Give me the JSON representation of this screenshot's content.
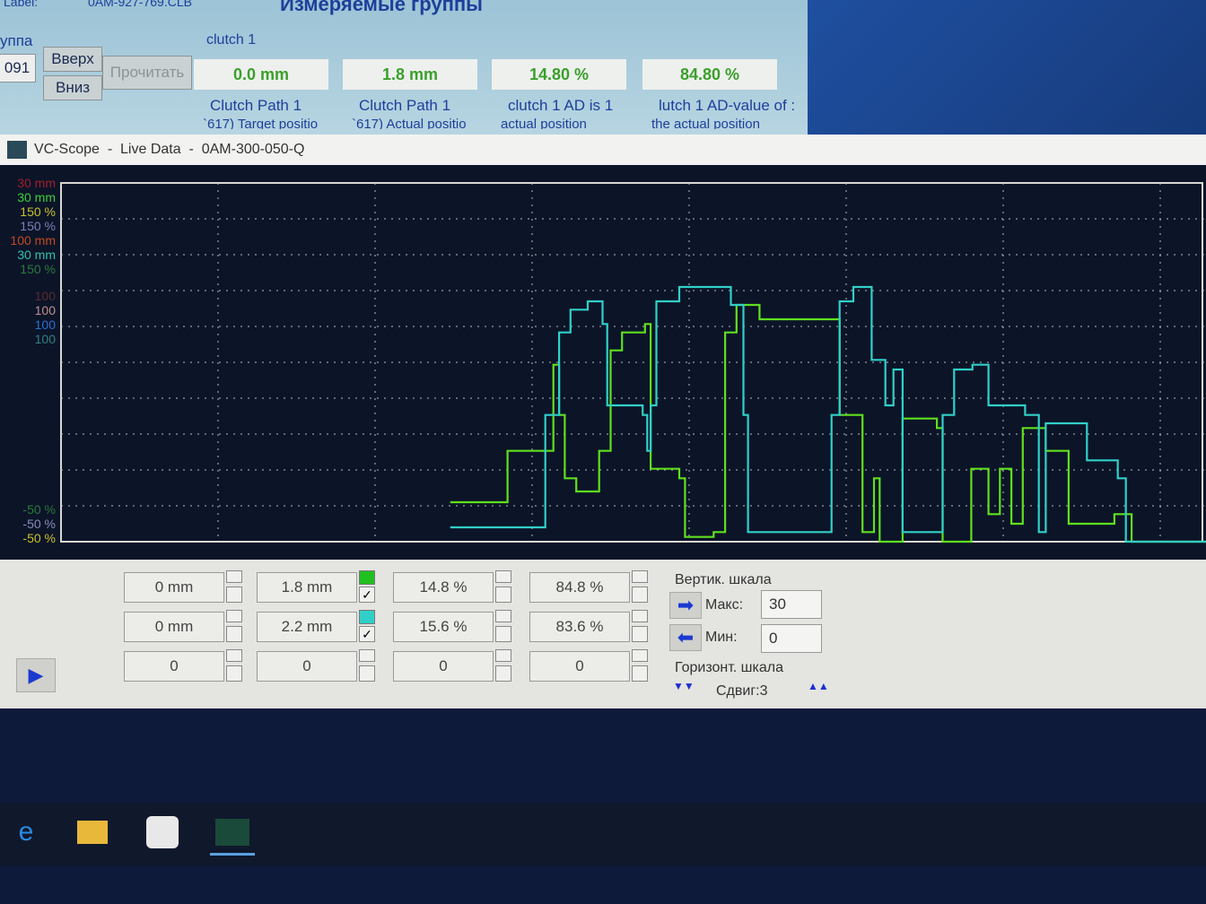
{
  "background_window": {
    "label": "Label:",
    "label_file": "0AM-927-769.CLB",
    "title": "Измеряемые группы",
    "group_label": "уппа",
    "group_value": "091",
    "up_button": "Вверх",
    "down_button": "Вниз",
    "read_button": "Прочитать",
    "section": "clutch 1",
    "values": [
      {
        "value": "0.0 mm",
        "name": "Clutch Path 1",
        "sub": "`617) Target positio"
      },
      {
        "value": "1.8 mm",
        "name": "Clutch Path 1",
        "sub": "`617) Actual positio"
      },
      {
        "value": "14.80 %",
        "name": "clutch 1 AD is 1",
        "sub": "actual position"
      },
      {
        "value": "84.80 %",
        "name": "lutch 1 AD-value of :",
        "sub": "the actual position"
      }
    ]
  },
  "scope": {
    "title": "VC-Scope  -  Live Data  -  0AM-300-050-Q",
    "scale_labels_top": [
      {
        "text": "30 mm",
        "color": "#a0202a"
      },
      {
        "text": "30 mm",
        "color": "#3ad03a"
      },
      {
        "text": "150 %",
        "color": "#c8c030"
      },
      {
        "text": "150 %",
        "color": "#7a80b8"
      },
      {
        "text": "100 mm",
        "color": "#c04a20"
      },
      {
        "text": "30 mm",
        "color": "#30c0b0"
      },
      {
        "text": "150 %",
        "color": "#2a7a3a"
      }
    ],
    "scale_labels_mid": [
      {
        "text": "100",
        "color": "#5a2a30"
      },
      {
        "text": "100",
        "color": "#c09090"
      },
      {
        "text": "100",
        "color": "#2a70d0"
      },
      {
        "text": "100",
        "color": "#308080"
      }
    ],
    "scale_labels_bottom": [
      {
        "text": "-50 %",
        "color": "#2a7a3a"
      },
      {
        "text": "-50 %",
        "color": "#8a8ab8"
      },
      {
        "text": "-50 %",
        "color": "#c8c030"
      }
    ],
    "rows": [
      {
        "cells": [
          "0 mm",
          "1.8 mm",
          "14.8 %",
          "84.8 %"
        ],
        "swatch": "#20c020",
        "checked": true
      },
      {
        "cells": [
          "0 mm",
          "2.2 mm",
          "15.6 %",
          "83.6 %"
        ],
        "swatch": "#30d0c8",
        "checked": true
      },
      {
        "cells": [
          "0",
          "0",
          "0",
          "0"
        ],
        "swatch": null,
        "checked": false
      }
    ],
    "vertical_scale": {
      "label": "Вертик. шкала",
      "max_label": "Макс:",
      "max": "30",
      "min_label": "Мин:",
      "min": "0"
    },
    "horizontal_scale": {
      "label": "Горизонт. шкала",
      "shift": "Сдвиг:3"
    }
  },
  "chart_data": {
    "type": "line",
    "ylim": [
      0,
      30
    ],
    "xlim": [
      0,
      100
    ],
    "grid": true,
    "series": [
      {
        "color": "#5ee01e",
        "points": [
          [
            34,
            3.3
          ],
          [
            39,
            7.6
          ],
          [
            43,
            14.8
          ],
          [
            43.5,
            10.6
          ],
          [
            44,
            5.3
          ],
          [
            45,
            4.2
          ],
          [
            47,
            7.6
          ],
          [
            48,
            16
          ],
          [
            49,
            17.5
          ],
          [
            51,
            18.2
          ],
          [
            51.5,
            6.1
          ],
          [
            54,
            5.3
          ],
          [
            54.5,
            0.4
          ],
          [
            57,
            0.8
          ],
          [
            58,
            17.5
          ],
          [
            59,
            19.8
          ],
          [
            60,
            19.8
          ],
          [
            61,
            18.6
          ],
          [
            67,
            18.6
          ],
          [
            68,
            10.6
          ],
          [
            70,
            0.8
          ],
          [
            71,
            5.3
          ],
          [
            71.5,
            0
          ],
          [
            73.5,
            10.3
          ],
          [
            76.5,
            9.5
          ],
          [
            77,
            0
          ],
          [
            79.5,
            6.1
          ],
          [
            81,
            2.3
          ],
          [
            82,
            6.1
          ],
          [
            83,
            1.5
          ],
          [
            84,
            9.5
          ],
          [
            86,
            7.6
          ],
          [
            88,
            1.5
          ],
          [
            92,
            2.3
          ],
          [
            93.5,
            0
          ],
          [
            100,
            0
          ]
        ]
      },
      {
        "color": "#30d0c8",
        "points": [
          [
            34,
            1.2
          ],
          [
            42,
            1.2
          ],
          [
            42.3,
            10.6
          ],
          [
            43.5,
            17.5
          ],
          [
            44.5,
            19.4
          ],
          [
            46,
            20.1
          ],
          [
            47.3,
            18.2
          ],
          [
            47.7,
            11.4
          ],
          [
            50.8,
            10.6
          ],
          [
            51.2,
            7.6
          ],
          [
            51.5,
            11.4
          ],
          [
            52,
            20.1
          ],
          [
            54,
            21.3
          ],
          [
            58,
            21.3
          ],
          [
            58.5,
            19.8
          ],
          [
            59.6,
            10.6
          ],
          [
            60,
            0.8
          ],
          [
            67,
            0.8
          ],
          [
            67.3,
            10.6
          ],
          [
            68,
            20.1
          ],
          [
            69.2,
            21.3
          ],
          [
            70.4,
            21.3
          ],
          [
            70.8,
            15.2
          ],
          [
            72,
            11.4
          ],
          [
            72.7,
            14.4
          ],
          [
            73.5,
            0.8
          ],
          [
            76.5,
            0.8
          ],
          [
            77,
            10.6
          ],
          [
            78,
            14.4
          ],
          [
            79.6,
            14.8
          ],
          [
            81,
            11.4
          ],
          [
            84.2,
            10.6
          ],
          [
            85.4,
            0.8
          ],
          [
            86,
            9.9
          ],
          [
            88,
            9.9
          ],
          [
            89.6,
            6.8
          ],
          [
            92.3,
            5.3
          ],
          [
            93,
            0
          ],
          [
            100,
            0
          ]
        ]
      }
    ]
  },
  "taskbar": {
    "icons": [
      "edge-icon",
      "file-explorer-icon",
      "task-app-icon",
      "vc-scope-icon"
    ]
  }
}
